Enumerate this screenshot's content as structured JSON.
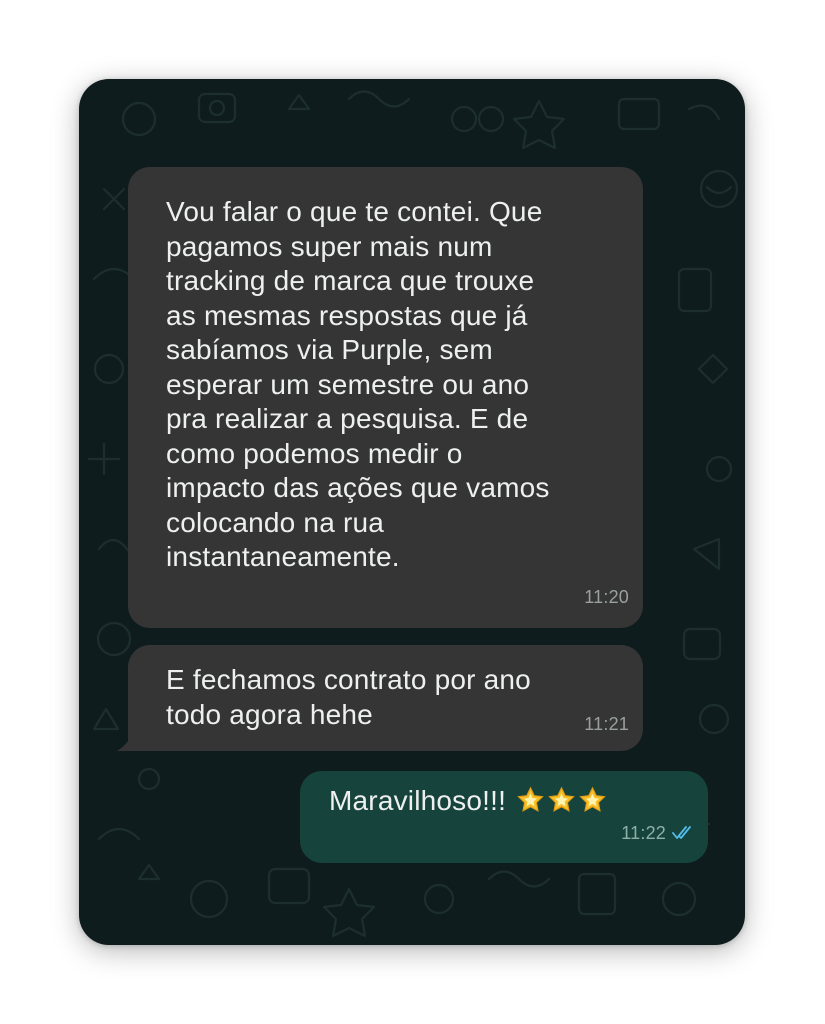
{
  "conversation": {
    "messages": [
      {
        "direction": "incoming",
        "text": "Vou falar o que te contei. Que\npagamos super mais num\ntracking de marca que trouxe\nas mesmas respostas que já\nsabíamos via Purple, sem\nesperar um semestre ou ano\npra realizar a pesquisa. E de\ncomo podemos medir o\nimpacto das ações que vamos\ncolocando na rua\ninstantaneamente.",
        "time": "11:20"
      },
      {
        "direction": "incoming",
        "text": "E fechamos contrato por ano\ntodo agora hehe",
        "time": "11:21"
      },
      {
        "direction": "outgoing",
        "text": "Maravilhoso!!!",
        "emoji": [
          "glowing-star",
          "glowing-star",
          "glowing-star"
        ],
        "time": "11:22",
        "status": "read"
      }
    ]
  },
  "colors": {
    "wallpaper": "#0f1c1d",
    "incoming_bubble": "#353535",
    "outgoing_bubble": "#16443c",
    "read_ticks": "#53bdeb"
  }
}
